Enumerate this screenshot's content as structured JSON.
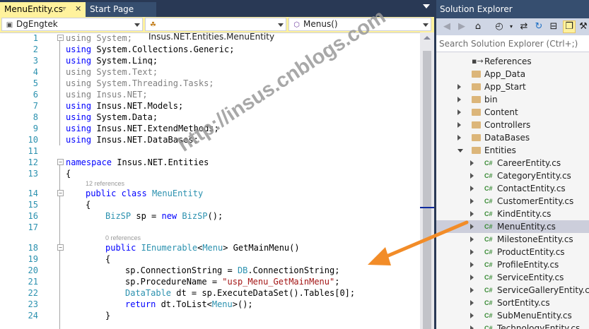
{
  "tabs": {
    "active": {
      "label": "MenuEntity.cs",
      "pin_icon": "pin-icon",
      "close_icon": "close-icon"
    },
    "inactive": {
      "label": "Start Page"
    }
  },
  "navbar": {
    "project": "DgEngtek",
    "type": "Insus.NET.Entities.MenuEntity",
    "member": "Menus()"
  },
  "code": {
    "lines": [
      {
        "n": "1"
      },
      {
        "n": "2"
      },
      {
        "n": "3"
      },
      {
        "n": "4"
      },
      {
        "n": "5"
      },
      {
        "n": "6"
      },
      {
        "n": "7"
      },
      {
        "n": "8"
      },
      {
        "n": "9"
      },
      {
        "n": "10"
      },
      {
        "n": "11"
      },
      {
        "n": "12"
      },
      {
        "n": "13"
      },
      {
        "n": "14"
      },
      {
        "n": "15"
      },
      {
        "n": "16"
      },
      {
        "n": "17"
      },
      {
        "n": "18"
      },
      {
        "n": "19"
      },
      {
        "n": "20"
      },
      {
        "n": "21"
      },
      {
        "n": "22"
      },
      {
        "n": "23"
      },
      {
        "n": "24"
      }
    ],
    "l1": [
      "using",
      " System;"
    ],
    "l2": [
      "using",
      " System.Collections.Generic;"
    ],
    "l3": [
      "using",
      " System.Linq;"
    ],
    "l4": [
      "using",
      " System.Text;"
    ],
    "l5": [
      "using",
      " System.Threading.Tasks;"
    ],
    "l6": [
      "using",
      " Insus.NET;"
    ],
    "l7": [
      "using",
      " Insus.NET.Models;"
    ],
    "l8": [
      "using",
      " System.Data;"
    ],
    "l9": [
      "using",
      " Insus.NET.ExtendMethods;"
    ],
    "l10": [
      "using",
      " Insus.NET.DataBases;"
    ],
    "l12": [
      "namespace",
      " Insus.NET.Entities"
    ],
    "l13": "{",
    "lens1": "12 references",
    "l14": [
      "public",
      " ",
      "class",
      " ",
      "MenuEntity"
    ],
    "l15": "{",
    "l16": [
      "BizSP",
      " sp = ",
      "new",
      " ",
      "BizSP",
      "();"
    ],
    "lens2": "0 references",
    "l18": [
      "public",
      " ",
      "IEnumerable",
      "<",
      "Menu",
      "> GetMainMenu()"
    ],
    "l19": "{",
    "l20": [
      "sp.ConnectionString = ",
      "DB",
      ".ConnectionString;"
    ],
    "l21": [
      "sp.ProcedureName = ",
      "\"usp_Menu_GetMainMenu\"",
      ";"
    ],
    "l22": [
      "DataTable",
      " dt = sp.ExecuteDataSet().Tables[0];"
    ],
    "l23": [
      "return",
      " dt.ToList<",
      "Menu",
      ">();"
    ],
    "l24": "}"
  },
  "watermark": "http://insus.cnblogs.com",
  "solution_explorer": {
    "title": "Solution Explorer",
    "search_placeholder": "Search Solution Explorer (Ctrl+;)",
    "cs_badge": "C#",
    "items": [
      {
        "label": "References",
        "kind": "references",
        "expander": "none"
      },
      {
        "label": "App_Data",
        "kind": "folder",
        "expander": "none"
      },
      {
        "label": "App_Start",
        "kind": "folder",
        "expander": "closed"
      },
      {
        "label": "bin",
        "kind": "folder",
        "expander": "closed"
      },
      {
        "label": "Content",
        "kind": "folder",
        "expander": "closed"
      },
      {
        "label": "Controllers",
        "kind": "folder",
        "expander": "closed"
      },
      {
        "label": "DataBases",
        "kind": "folder",
        "expander": "closed"
      },
      {
        "label": "Entities",
        "kind": "folder",
        "expander": "open"
      },
      {
        "label": "CareerEntity.cs",
        "kind": "cs",
        "expander": "closed"
      },
      {
        "label": "CategoryEntity.cs",
        "kind": "cs",
        "expander": "closed"
      },
      {
        "label": "ContactEntity.cs",
        "kind": "cs",
        "expander": "closed"
      },
      {
        "label": "CustomerEntity.cs",
        "kind": "cs",
        "expander": "closed"
      },
      {
        "label": "KindEntity.cs",
        "kind": "cs",
        "expander": "closed"
      },
      {
        "label": "MenuEntity.cs",
        "kind": "cs",
        "expander": "closed",
        "selected": true
      },
      {
        "label": "MilestoneEntity.cs",
        "kind": "cs",
        "expander": "closed"
      },
      {
        "label": "ProductEntity.cs",
        "kind": "cs",
        "expander": "closed"
      },
      {
        "label": "ProfileEntity.cs",
        "kind": "cs",
        "expander": "closed"
      },
      {
        "label": "ServiceEntity.cs",
        "kind": "cs",
        "expander": "closed"
      },
      {
        "label": "ServiceGalleryEntity.cs",
        "kind": "cs",
        "expander": "closed"
      },
      {
        "label": "SortEntity.cs",
        "kind": "cs",
        "expander": "closed"
      },
      {
        "label": "SubMenuEntity.cs",
        "kind": "cs",
        "expander": "closed"
      },
      {
        "label": "TechnologyEntity.cs",
        "kind": "cs",
        "expander": "closed"
      }
    ]
  },
  "colors": {
    "accent": "#FFF29D",
    "chrome": "#293955",
    "keyword": "#0000FF",
    "type": "#2B91AF",
    "string": "#A31515",
    "arrow": "#F28C28"
  }
}
